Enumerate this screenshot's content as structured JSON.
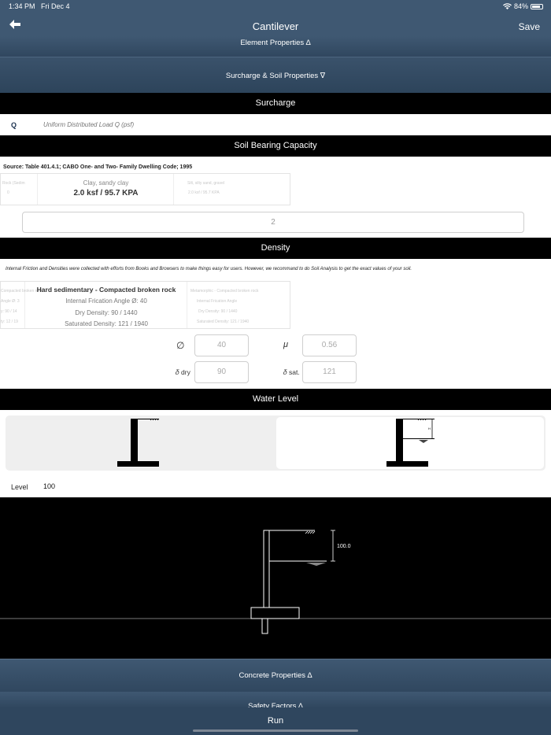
{
  "status": {
    "time": "1:34 PM",
    "date": "Fri Dec 4",
    "battery": "84%"
  },
  "header": {
    "title": "Cantilever",
    "save_label": "Save",
    "back_icon": "arrow-left-icon"
  },
  "sections": {
    "element_properties": "Element Properties ∆",
    "surcharge_soil": "Surcharge & Soil Properties ∇",
    "surcharge": "Surcharge",
    "soil_bearing": "Soil Bearing Capacity",
    "density": "Density",
    "water_level": "Water Level",
    "concrete_properties": "Concrete Properties ∆",
    "safety_factors": "Safety Factors ∆"
  },
  "surcharge": {
    "label": "Q",
    "placeholder": "Uniform Distributed Load Q (psf)"
  },
  "soil_bearing": {
    "source": "Source: Table 401.4.1; CABO One- and Two- Family Dwelling Code; 1995",
    "picker_left_top": "Rock (Sedim",
    "picker_left_bottom": "0",
    "selected_top": "Clay, sandy clay",
    "selected_main": "2.0 ksf / 95.7 KPA",
    "picker_right_top": "Silt, silty sand, gravel",
    "picker_right_bottom": "2.0 ksf / 95.7 KPA",
    "count": "2"
  },
  "density": {
    "note": "Internal Friction and Densities were collected with efforts from Books and Browsers to make things easy for users. However, we recommand to do Soil Analysis to get the exact values of your soil.",
    "left_faded": [
      "Compacted broken rock",
      "Angle Ø: 3",
      "y: 90 / 14",
      "ty: 12 / 19"
    ],
    "selected_title": "Hard sedimentary - Compacted broken rock",
    "selected_lines": [
      "Internal Frication Angle Ø: 40",
      "Dry Density: 90 / 1440",
      "Saturated Density: 121 / 1940"
    ],
    "right_faded": [
      "Metamorphic - Compacted broken rock",
      "Internal Frication Angle",
      "Dry Density: 90 / 1440",
      "Saturated Density: 121 / 1940"
    ],
    "phi_label": "∅",
    "phi_value": "40",
    "mu_label": "μ",
    "mu_value": "0.56",
    "dry_label": "𝛿 dry",
    "dry_value": "90",
    "sat_label": "𝛿 sat.",
    "sat_value": "121"
  },
  "water_level": {
    "level_label": "Level",
    "level_value": "100",
    "dim_label": "100.0"
  },
  "footer": {
    "run_label": "Run"
  }
}
